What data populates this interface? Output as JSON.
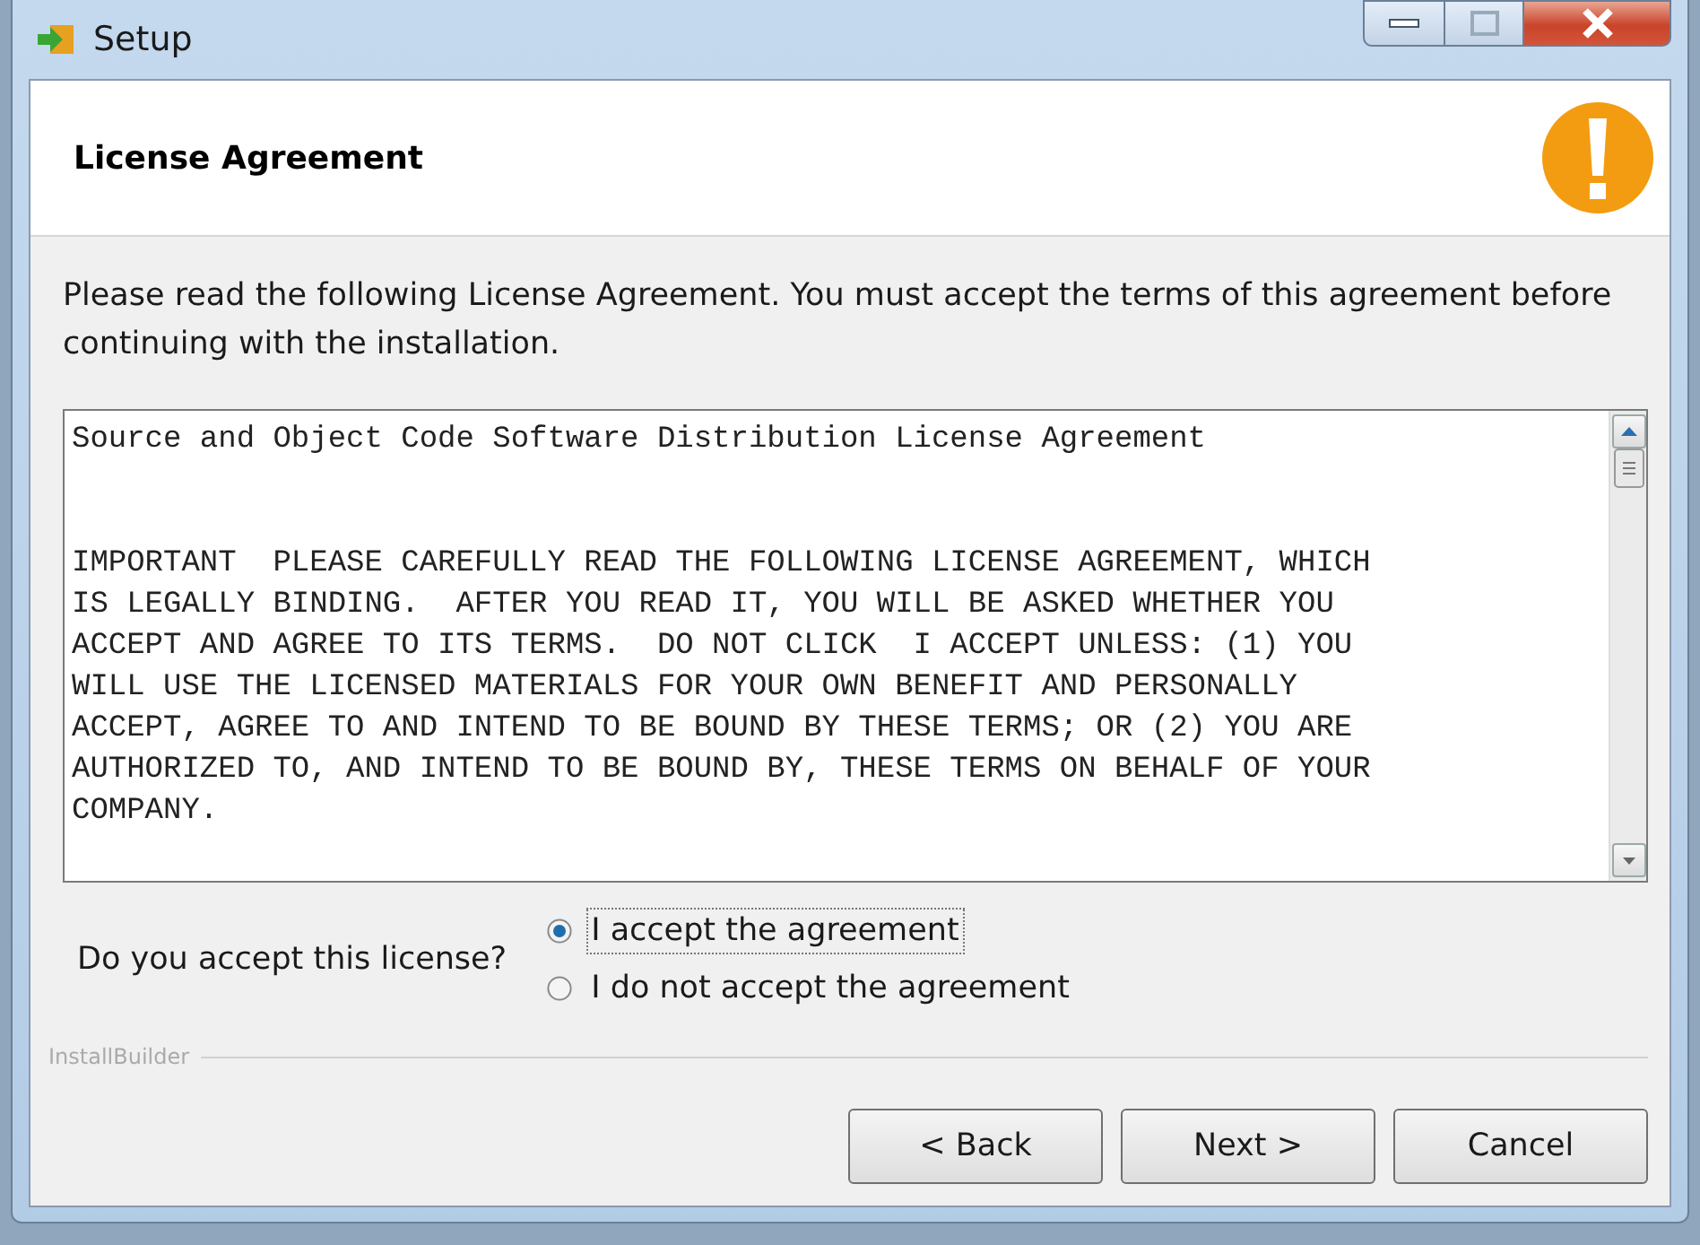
{
  "window": {
    "title": "Setup"
  },
  "header": {
    "title": "License Agreement"
  },
  "intro": "Please read the following License Agreement. You must accept the terms of this agreement before continuing with the installation.",
  "license_text": "Source and Object Code Software Distribution License Agreement\n\n\nIMPORTANT  PLEASE CAREFULLY READ THE FOLLOWING LICENSE AGREEMENT, WHICH\nIS LEGALLY BINDING.  AFTER YOU READ IT, YOU WILL BE ASKED WHETHER YOU\nACCEPT AND AGREE TO ITS TERMS.  DO NOT CLICK  I ACCEPT UNLESS: (1) YOU\nWILL USE THE LICENSED MATERIALS FOR YOUR OWN BENEFIT AND PERSONALLY\nACCEPT, AGREE TO AND INTEND TO BE BOUND BY THESE TERMS; OR (2) YOU ARE\nAUTHORIZED TO, AND INTEND TO BE BOUND BY, THESE TERMS ON BEHALF OF YOUR\nCOMPANY.",
  "question": "Do you accept this license?",
  "options": [
    {
      "label": "I accept the agreement",
      "selected": true
    },
    {
      "label": "I do not accept the agreement",
      "selected": false
    }
  ],
  "brand": "InstallBuilder",
  "buttons": [
    "< Back",
    "Next >",
    "Cancel"
  ]
}
